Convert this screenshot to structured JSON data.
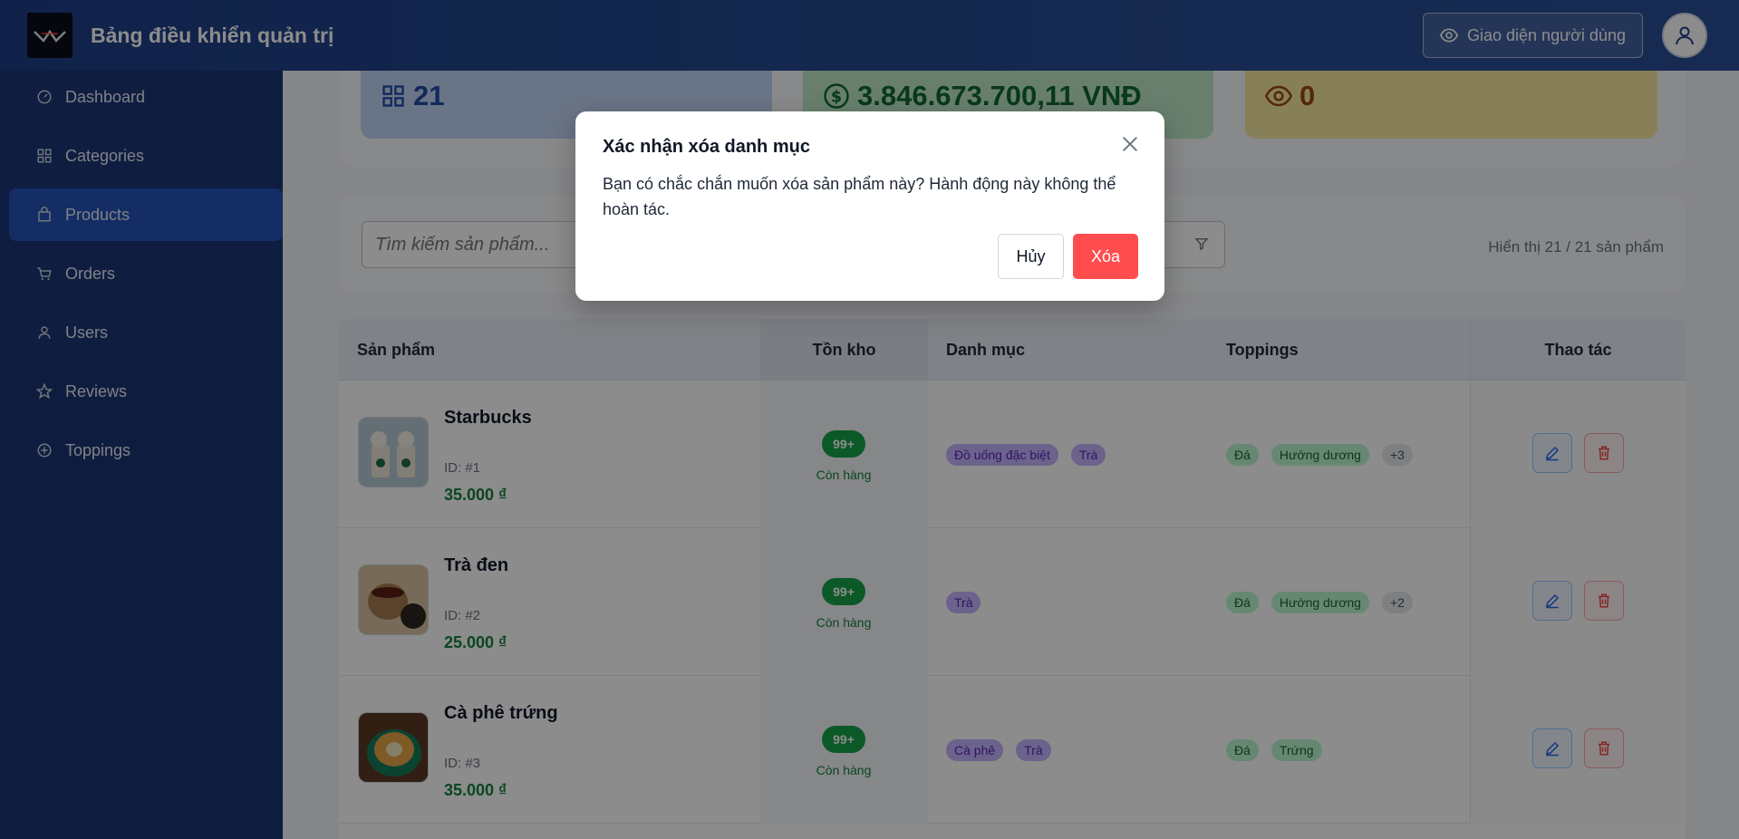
{
  "header": {
    "title": "Bảng điều khiển quản trị",
    "user_view_label": "Giao diện người dùng"
  },
  "sidebar": {
    "items": [
      {
        "label": "Dashboard",
        "icon": "dashboard-icon"
      },
      {
        "label": "Categories",
        "icon": "grid-icon"
      },
      {
        "label": "Products",
        "icon": "bag-icon",
        "active": true
      },
      {
        "label": "Orders",
        "icon": "cart-icon"
      },
      {
        "label": "Users",
        "icon": "user-icon"
      },
      {
        "label": "Reviews",
        "icon": "star-icon"
      },
      {
        "label": "Toppings",
        "icon": "plus-circle-icon"
      }
    ]
  },
  "stats": {
    "products": "21",
    "revenue": "3.846.673.700,11 VNĐ",
    "views": "0"
  },
  "filter": {
    "search_placeholder": "Tìm kiếm sản phẩm...",
    "result_count": "Hiển thị 21 / 21 sản phẩm"
  },
  "table": {
    "headers": [
      "Sản phẩm",
      "Tồn kho",
      "Danh mục",
      "Toppings",
      "Thao tác"
    ],
    "rows": [
      {
        "name": "Starbucks",
        "id": "ID: #1",
        "price": "35.000 ₫",
        "stock": "99+",
        "stock_status": "Còn hàng",
        "categories": [
          "Đồ uống đặc biệt",
          "Trà"
        ],
        "toppings": [
          "Đá",
          "Hướng dương"
        ],
        "more": "+3"
      },
      {
        "name": "Trà đen",
        "id": "ID: #2",
        "price": "25.000 ₫",
        "stock": "99+",
        "stock_status": "Còn hàng",
        "categories": [
          "Trà"
        ],
        "toppings": [
          "Đá",
          "Hướng dương"
        ],
        "more": "+2"
      },
      {
        "name": "Cà phê trứng",
        "id": "ID: #3",
        "price": "35.000 ₫",
        "stock": "99+",
        "stock_status": "Còn hàng",
        "categories": [
          "Cà phê",
          "Trà"
        ],
        "toppings": [
          "Đá",
          "Trứng"
        ],
        "more": ""
      }
    ]
  },
  "modal": {
    "title": "Xác nhận xóa danh mục",
    "body": "Bạn có chắc chắn muốn xóa sản phẩm này? Hành động này không thể hoàn tác.",
    "cancel_label": "Hủy",
    "delete_label": "Xóa"
  },
  "colors": {
    "header": "#26498f",
    "sidebar": "#1c3677",
    "active": "#2552b8",
    "delete": "#ff4d4f"
  }
}
